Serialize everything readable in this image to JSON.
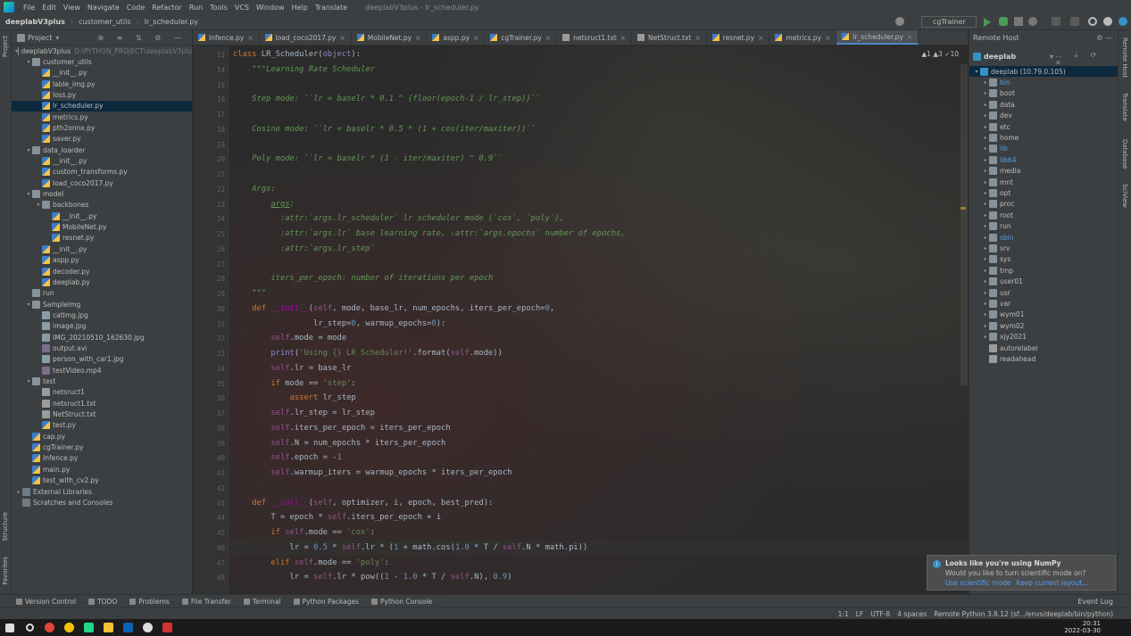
{
  "menu": {
    "items": [
      "File",
      "Edit",
      "View",
      "Navigate",
      "Code",
      "Refactor",
      "Run",
      "Tools",
      "VCS",
      "Window",
      "Help",
      "Translate"
    ],
    "window_title": "deeplabV3plus - lr_scheduler.py"
  },
  "nav": {
    "crumbs": [
      "deeplabV3plus",
      "customer_utils",
      "lr_scheduler.py"
    ],
    "run_config": "cgTrainer"
  },
  "project": {
    "header": "Project",
    "tree": [
      {
        "label": "deeplabV3plus",
        "hint": "D:\\PYTHON_PROJECT\\deeplabV3plu",
        "type": "folder",
        "depth": 0,
        "open": true
      },
      {
        "label": "customer_utils",
        "type": "folder",
        "depth": 1,
        "open": true
      },
      {
        "label": "__init__.py",
        "type": "py",
        "depth": 2
      },
      {
        "label": "lable_img.py",
        "type": "py",
        "depth": 2
      },
      {
        "label": "loss.py",
        "type": "py",
        "depth": 2
      },
      {
        "label": "lr_scheduler.py",
        "type": "py",
        "depth": 2,
        "selected": true
      },
      {
        "label": "metrics.py",
        "type": "py",
        "depth": 2
      },
      {
        "label": "pth2onnx.py",
        "type": "py",
        "depth": 2
      },
      {
        "label": "saver.py",
        "type": "py",
        "depth": 2
      },
      {
        "label": "data_loarder",
        "type": "folder",
        "depth": 1,
        "open": true
      },
      {
        "label": "__init__.py",
        "type": "py",
        "depth": 2
      },
      {
        "label": "custom_transforms.py",
        "type": "py",
        "depth": 2
      },
      {
        "label": "load_coco2017.py",
        "type": "py",
        "depth": 2
      },
      {
        "label": "model",
        "type": "folder",
        "depth": 1,
        "open": true
      },
      {
        "label": "backbones",
        "type": "folder",
        "depth": 2,
        "open": true
      },
      {
        "label": "__init__.py",
        "type": "py",
        "depth": 3
      },
      {
        "label": "MobileNet.py",
        "type": "py",
        "depth": 3
      },
      {
        "label": "resnet.py",
        "type": "py",
        "depth": 3
      },
      {
        "label": "__init__.py",
        "type": "py",
        "depth": 2
      },
      {
        "label": "aspp.py",
        "type": "py",
        "depth": 2
      },
      {
        "label": "decoder.py",
        "type": "py",
        "depth": 2
      },
      {
        "label": "deeplab.py",
        "type": "py",
        "depth": 2
      },
      {
        "label": "run",
        "type": "folder",
        "depth": 1,
        "open": false,
        "noarrow": true
      },
      {
        "label": "SampleImg",
        "type": "folder",
        "depth": 1,
        "open": true
      },
      {
        "label": "catImg.jpg",
        "type": "img",
        "depth": 2
      },
      {
        "label": "image.jpg",
        "type": "img",
        "depth": 2
      },
      {
        "label": "IMG_20210510_162630.jpg",
        "type": "img",
        "depth": 2
      },
      {
        "label": "output.avi",
        "type": "vid",
        "depth": 2
      },
      {
        "label": "person_with_car1.jpg",
        "type": "img",
        "depth": 2
      },
      {
        "label": "testVideo.mp4",
        "type": "vid",
        "depth": 2
      },
      {
        "label": "test",
        "type": "folder",
        "depth": 1,
        "open": true
      },
      {
        "label": "netsruct1",
        "type": "txt",
        "depth": 2
      },
      {
        "label": "netsruct1.txt",
        "type": "txt",
        "depth": 2
      },
      {
        "label": "NetStruct.txt",
        "type": "txt",
        "depth": 2
      },
      {
        "label": "test.py",
        "type": "py",
        "depth": 2
      },
      {
        "label": "cap.py",
        "type": "py",
        "depth": 1
      },
      {
        "label": "cgTrainer.py",
        "type": "py",
        "depth": 1
      },
      {
        "label": "Infence.py",
        "type": "py",
        "depth": 1
      },
      {
        "label": "main.py",
        "type": "py",
        "depth": 1
      },
      {
        "label": "test_with_cv2.py",
        "type": "py",
        "depth": 1
      },
      {
        "label": "External Libraries",
        "type": "lib",
        "depth": 0,
        "open": false
      },
      {
        "label": "Scratches and Consoles",
        "type": "lib",
        "depth": 0,
        "open": false,
        "noarrow": true
      }
    ]
  },
  "tabs": [
    {
      "label": "Infence.py",
      "icon": "py"
    },
    {
      "label": "load_coco2017.py",
      "icon": "py"
    },
    {
      "label": "MobileNet.py",
      "icon": "py"
    },
    {
      "label": "aspp.py",
      "icon": "py"
    },
    {
      "label": "cgTrainer.py",
      "icon": "py"
    },
    {
      "label": "netsruct1.txt",
      "icon": "txt"
    },
    {
      "label": "NetStruct.txt",
      "icon": "txt"
    },
    {
      "label": "resnet.py",
      "icon": "py"
    },
    {
      "label": "metrics.py",
      "icon": "py"
    },
    {
      "label": "lr_scheduler.py",
      "icon": "py",
      "active": true
    }
  ],
  "inspections": "▲1  ▲3  ✓10",
  "code_lines": [
    {
      "n": 13,
      "html": "<span class='kw'>class</span> <span class='fn' style='color:#a9b7c6'>LR_Scheduler</span>(<span class='kw' style='color:#8888c6'>object</span>):"
    },
    {
      "n": 14,
      "html": "    <span class='doc'>\"\"\"Learning Rate Scheduler</span>"
    },
    {
      "n": 15,
      "html": ""
    },
    {
      "n": 16,
      "html": "    <span class='doc'>Step mode: ``lr = baselr * 0.1 ^ {floor(epoch-1 / lr_step)}``</span>"
    },
    {
      "n": 17,
      "html": ""
    },
    {
      "n": 18,
      "html": "    <span class='doc'>Cosine mode: ``lr = baselr * 0.5 * (1 + cos(iter/maxiter))``</span>"
    },
    {
      "n": 19,
      "html": ""
    },
    {
      "n": 20,
      "html": "    <span class='doc'>Poly mode: ``lr = baselr * (1 - iter/maxiter) ^ 0.9``</span>"
    },
    {
      "n": 21,
      "html": ""
    },
    {
      "n": 22,
      "html": "    <span class='doc'>Args:</span>"
    },
    {
      "n": 23,
      "html": "        <span class='doc' style='text-decoration:underline'>args</span><span class='doc'>:</span>"
    },
    {
      "n": 24,
      "html": "          <span class='doc'>:attr:`args.lr_scheduler` lr scheduler mode (`cos`, `poly`),</span>"
    },
    {
      "n": 25,
      "html": "          <span class='doc'>:attr:`args.lr` base learning rate, :attr:`args.epochs` number of epochs,</span>"
    },
    {
      "n": 26,
      "html": "          <span class='doc'>:attr:`args.lr_step`</span>"
    },
    {
      "n": 27,
      "html": ""
    },
    {
      "n": 28,
      "html": "        <span class='doc'>iters_per_epoch: number of iterations per epoch</span>"
    },
    {
      "n": 29,
      "html": "    <span class='doc'>\"\"\"</span>"
    },
    {
      "n": 30,
      "html": "    <span class='kw'>def</span> <span class='dund'>__init__</span>(<span class='self'>self</span>, mode, base_lr, num_epochs, iters_per_epoch=<span class='num'>0</span>,"
    },
    {
      "n": 31,
      "html": "                 lr_step=<span class='num'>0</span>, warmup_epochs=<span class='num'>0</span>):"
    },
    {
      "n": 32,
      "html": "        <span class='self'>self</span>.mode = mode"
    },
    {
      "n": 33,
      "html": "        <span style='color:#8888c6'>print</span>(<span class='str'>'Using {} LR Scheduler!'</span>.format(<span class='self'>self</span>.mode))"
    },
    {
      "n": 34,
      "html": "        <span class='self'>self</span>.lr = base_lr"
    },
    {
      "n": 35,
      "html": "        <span class='kw'>if</span> mode == <span class='str'>'step'</span>:"
    },
    {
      "n": 36,
      "html": "            <span class='kw'>assert</span> lr_step"
    },
    {
      "n": 37,
      "html": "        <span class='self'>self</span>.lr_step = lr_step"
    },
    {
      "n": 38,
      "html": "        <span class='self'>self</span>.iters_per_epoch = iters_per_epoch"
    },
    {
      "n": 39,
      "html": "        <span class='self'>self</span>.N = num_epochs * iters_per_epoch"
    },
    {
      "n": 40,
      "html": "        <span class='self'>self</span>.epoch = -<span class='num'>1</span>"
    },
    {
      "n": 41,
      "html": "        <span class='self'>self</span>.warmup_iters = warmup_epochs * iters_per_epoch"
    },
    {
      "n": 42,
      "html": ""
    },
    {
      "n": 43,
      "html": "    <span class='kw'>def</span> <span class='dund'>__call__</span>(<span class='self'>self</span>, optimizer, i, epoch, best_pred):"
    },
    {
      "n": 44,
      "html": "        T = epoch * <span class='self'>self</span>.iters_per_epoch + i"
    },
    {
      "n": 45,
      "html": "        <span class='kw'>if</span> <span class='self'>self</span>.mode == <span class='str'>'cos'</span>:"
    },
    {
      "n": 46,
      "html": "            lr = <span class='num'>0.5</span> * <span class='self'>self</span>.lr * (<span class='num'>1</span> + math.cos(<span class='num'>1.0</span> * T / <span class='self'>self</span>.N * math.pi))"
    },
    {
      "n": 47,
      "html": "        <span class='kw'>elif</span> <span class='self'>self</span>.mode == <span class='str'>'poly'</span>:"
    },
    {
      "n": 48,
      "html": "            lr = <span class='self'>self</span>.lr * pow((<span class='num'>1</span> - <span class='num'>1.0</span> * T / <span class='self'>self</span>.N), <span class='num'>0.9</span>)"
    }
  ],
  "remote": {
    "header": "Remote Host",
    "server": "deeplab",
    "root": "deeplab (10.79.0.105)",
    "dirs": [
      {
        "label": "bin",
        "blue": true
      },
      {
        "label": "boot"
      },
      {
        "label": "data"
      },
      {
        "label": "dev"
      },
      {
        "label": "etc"
      },
      {
        "label": "home"
      },
      {
        "label": "lib",
        "blue": true
      },
      {
        "label": "lib64",
        "blue": true
      },
      {
        "label": "media"
      },
      {
        "label": "mnt"
      },
      {
        "label": "opt"
      },
      {
        "label": "proc"
      },
      {
        "label": "root"
      },
      {
        "label": "run"
      },
      {
        "label": "sbin",
        "blue": true
      },
      {
        "label": "srv"
      },
      {
        "label": "sys"
      },
      {
        "label": "tmp"
      },
      {
        "label": "user01"
      },
      {
        "label": "usr"
      },
      {
        "label": "var"
      },
      {
        "label": "wym01"
      },
      {
        "label": "wym02"
      },
      {
        "label": "xjy2021"
      },
      {
        "label": "autorelabel",
        "file": true
      },
      {
        "label": "readahead",
        "file": true
      }
    ]
  },
  "right_strip": [
    "Remote Host",
    "Translate",
    "Database",
    "SciView"
  ],
  "left_strip": [
    "Project",
    "Structure",
    "Favorites"
  ],
  "popup": {
    "title": "Looks like you're using NumPy",
    "message": "Would you like to turn scientific mode on?",
    "link1": "Use scientific mode",
    "link2": "Keep current layout..."
  },
  "bottom_tools": [
    "Version Control",
    "TODO",
    "Problems",
    "File Transfer",
    "Terminal",
    "Python Packages",
    "Python Console"
  ],
  "event_log": "Event Log",
  "status": {
    "pos": "1:1",
    "eol": "LF",
    "enc": "UTF-8",
    "indent": "4 spaces",
    "interp": "Remote Python 3.8.12 (sf.../envs/deeplab/bin/python)"
  },
  "clock": {
    "time": "20:31",
    "date": "2022-03-30"
  }
}
